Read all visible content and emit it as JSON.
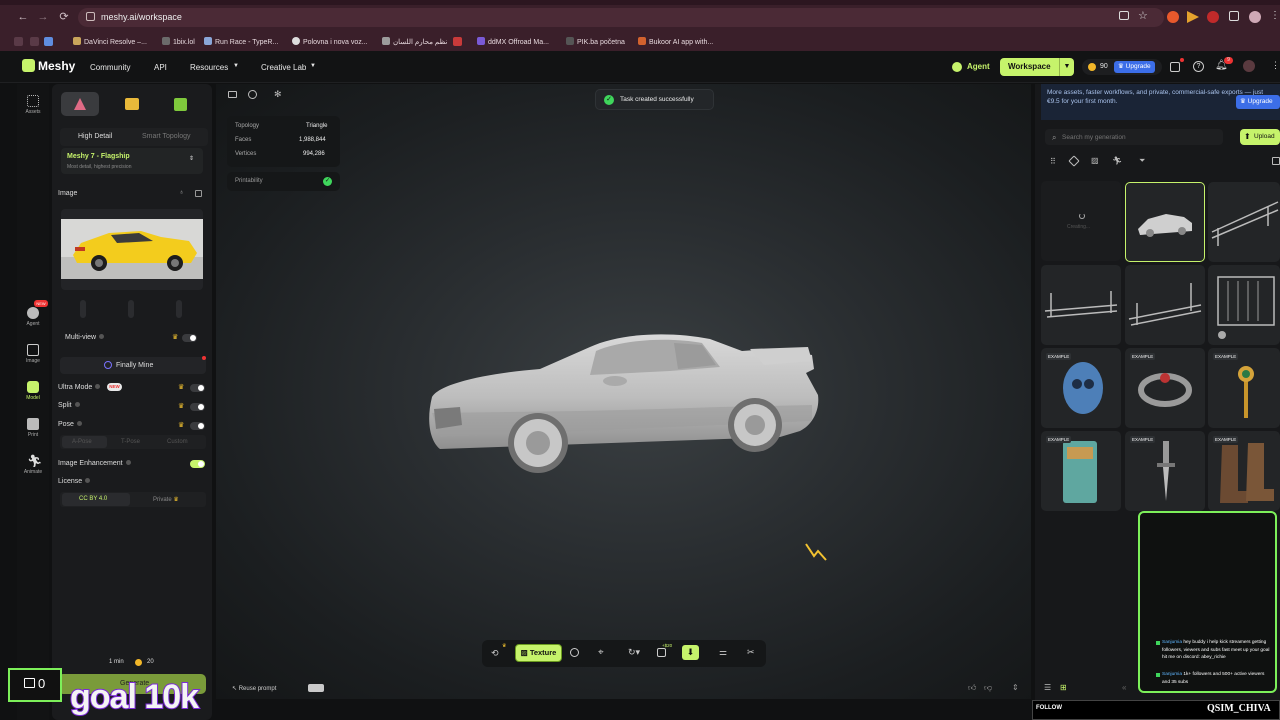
{
  "browser": {
    "url": "meshy.ai/workspace",
    "bookmarks": [
      "DaVinci Resolve –...",
      "1bix.lol",
      "Run Race - TypeR...",
      "Polovna i nova voz...",
      "نظم محارم اللسان",
      "ddMX Offroad Ma...",
      "PIK.ba početna",
      "Bukoor AI app with..."
    ]
  },
  "nav": {
    "logo": "Meshy",
    "items": [
      "Community",
      "API",
      "Resources",
      "Creative Lab"
    ],
    "agent": "Agent",
    "workspace": "Workspace",
    "credits": "90",
    "upgrade": "Upgrade",
    "notif_count": "9"
  },
  "rail": {
    "items": [
      "Assets",
      "Agent",
      "Image",
      "Model",
      "Print",
      "Animate"
    ],
    "new_badge": "NEW"
  },
  "left_panel": {
    "tabs": [
      "High Detail",
      "Smart Topology"
    ],
    "model_name": "Meshy 7 - Flagship",
    "model_desc": "Most detail, highest precision",
    "image_label": "Image",
    "multiview": "Multi-view",
    "project": "Finally Mine",
    "ultra_mode": "Ultra Mode",
    "ultra_badge": "NEW",
    "split": "Split",
    "pose": "Pose",
    "pose_options": [
      "A-Pose",
      "T-Pose",
      "Custom"
    ],
    "image_enhancement": "Image Enhancement",
    "license": "License",
    "license_options": [
      "CC BY 4.0",
      "Private"
    ],
    "time": "1 min",
    "cost": "20",
    "generate": "Generate"
  },
  "viewport": {
    "stats": [
      {
        "label": "Topology",
        "value": "Triangle"
      },
      {
        "label": "Faces",
        "value": "1,988,844"
      },
      {
        "label": "Vertices",
        "value": "994,286"
      }
    ],
    "printability": "Printability",
    "toast": "Task created successfully",
    "texture_btn": "Texture",
    "cost_tag": "+$20",
    "reuse_prompt": "Reuse prompt"
  },
  "right_panel": {
    "promo": "More assets, faster workflows, and private, commercial-safe exports — just €9.5 for your first month.",
    "upgrade": "Upgrade",
    "search_placeholder": "Search my generation",
    "upload": "Upload",
    "creating": "Creating...",
    "example_badge": "EXAMPLE"
  },
  "stream": {
    "chat": [
      {
        "user": "Sanjumia",
        "text": "hey buddy i help kick streamers getting followers, viewers and subs fast meet up your goal hit me on discord: abey_richie"
      },
      {
        "user": "Sanjumia",
        "text": "1k+ followers and 500+ active viewers and 35 subs"
      }
    ],
    "follow": "FOLLOW",
    "streamer": "QSIM_CHIVA",
    "counter": "0",
    "goal": "goal 10k"
  }
}
